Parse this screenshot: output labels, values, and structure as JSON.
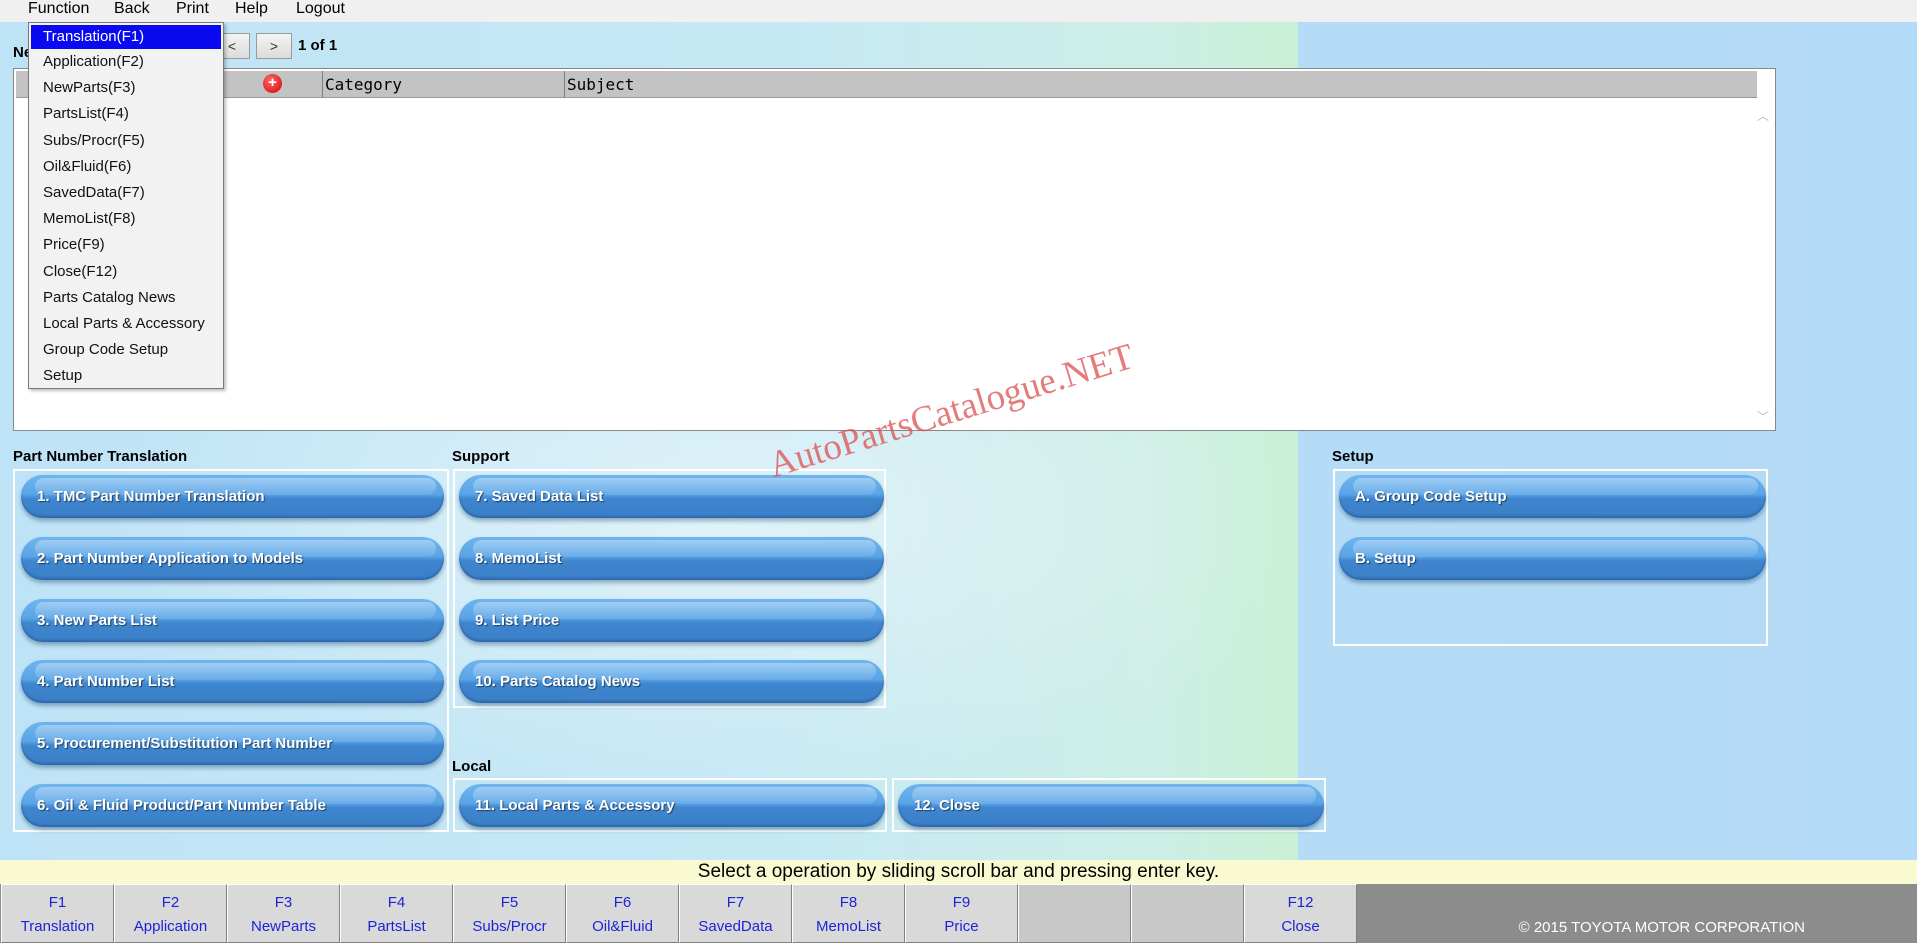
{
  "menubar": {
    "items": [
      "Function",
      "Back",
      "Print",
      "Help",
      "Logout"
    ]
  },
  "function_menu": {
    "items": [
      "Translation(F1)",
      "Application(F2)",
      "NewParts(F3)",
      "PartsList(F4)",
      "Subs/Procr(F5)",
      "Oil&Fluid(F6)",
      "SavedData(F7)",
      "MemoList(F8)",
      "Price(F9)",
      "Close(F12)",
      "Parts Catalog News",
      "Local Parts & Accessory",
      "Group Code Setup",
      "Setup"
    ],
    "selected": "Translation(F1)"
  },
  "news": {
    "label": "Ne",
    "prev_label": "<",
    "next_label": ">",
    "pager": "1 of 1",
    "columns": [
      "Category",
      "Subject"
    ],
    "add_icon": "plus-circle-icon",
    "plus_glyph": "+",
    "scroll_up": "︿",
    "scroll_down": "﹀"
  },
  "sections": {
    "translation": {
      "label": "Part Number Translation",
      "buttons": [
        "1. TMC Part Number Translation",
        "2. Part Number Application to Models",
        "3. New Parts List",
        "4. Part Number List",
        "5. Procurement/Substitution Part Number",
        "6. Oil & Fluid Product/Part Number Table"
      ]
    },
    "support": {
      "label": "Support",
      "buttons": [
        "7. Saved Data List",
        "8. MemoList",
        "9. List Price",
        "10. Parts Catalog News"
      ]
    },
    "setup": {
      "label": "Setup",
      "buttons": [
        "A. Group Code Setup",
        "B. Setup"
      ]
    },
    "local": {
      "label": "Local",
      "buttons": [
        "11. Local Parts & Accessory",
        "12. Close"
      ]
    }
  },
  "watermark": "AutoPartsCatalogue.NET",
  "status_text": "Select a operation by sliding scroll bar and pressing enter key.",
  "fkeys": [
    {
      "key": "F1",
      "label": "Translation"
    },
    {
      "key": "F2",
      "label": "Application"
    },
    {
      "key": "F3",
      "label": "NewParts"
    },
    {
      "key": "F4",
      "label": "PartsList"
    },
    {
      "key": "F5",
      "label": "Subs/Procr"
    },
    {
      "key": "F6",
      "label": "Oil&Fluid"
    },
    {
      "key": "F7",
      "label": "SavedData"
    },
    {
      "key": "F8",
      "label": "MemoList"
    },
    {
      "key": "F9",
      "label": "Price"
    },
    {
      "key": "",
      "label": ""
    },
    {
      "key": "",
      "label": ""
    },
    {
      "key": "F12",
      "label": "Close"
    }
  ],
  "copyright": "© 2015 TOYOTA MOTOR CORPORATION"
}
